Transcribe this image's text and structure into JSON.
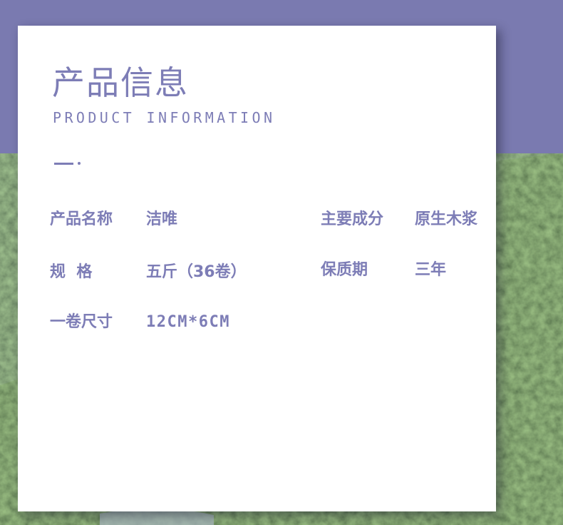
{
  "title_cn": "产品信息",
  "title_en": "PRODUCT INFORMATION",
  "specs": {
    "name": {
      "label": "产品名称",
      "value": "洁唯"
    },
    "ingredient": {
      "label": "主要成分",
      "value": "原生木浆"
    },
    "spec": {
      "label": "规  格",
      "value": "五斤（36卷）"
    },
    "shelf_life": {
      "label": "保质期",
      "value": "三年"
    },
    "roll_size": {
      "label": "一卷尺寸",
      "value": "12CM*6CM"
    }
  },
  "colors": {
    "accent": "#7d7db6",
    "background": "#7a7ab0",
    "card": "#ffffff",
    "foliage": "#3f5a34"
  }
}
